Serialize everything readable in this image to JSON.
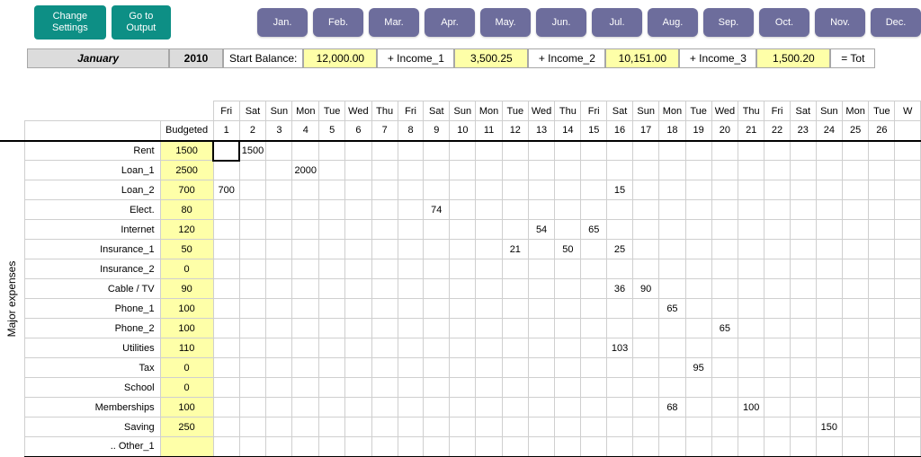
{
  "buttons": {
    "change_settings": "Change\nSettings",
    "goto_output": "Go to\nOutput"
  },
  "months": [
    "Jan.",
    "Feb.",
    "Mar.",
    "Apr.",
    "May.",
    "Jun.",
    "Jul.",
    "Aug.",
    "Sep.",
    "Oct.",
    "Nov.",
    "Dec."
  ],
  "balance_row": {
    "month_name": "January",
    "year": "2010",
    "start_balance_label": "Start Balance:",
    "start_balance": "12,000.00",
    "income1_label": "+ Income_1",
    "income1": "3,500.25",
    "income2_label": "+ Income_2",
    "income2": "10,151.00",
    "income3_label": "+ Income_3",
    "income3": "1,500.20",
    "total_label": "= Tot"
  },
  "header": {
    "budgeted": "Budgeted",
    "days_of_week": [
      "Fri",
      "Sat",
      "Sun",
      "Mon",
      "Tue",
      "Wed",
      "Thu",
      "Fri",
      "Sat",
      "Sun",
      "Mon",
      "Tue",
      "Wed",
      "Thu",
      "Fri",
      "Sat",
      "Sun",
      "Mon",
      "Tue",
      "Wed",
      "Thu",
      "Fri",
      "Sat",
      "Sun",
      "Mon",
      "Tue",
      "W"
    ],
    "day_numbers": [
      "1",
      "2",
      "3",
      "4",
      "5",
      "6",
      "7",
      "8",
      "9",
      "10",
      "11",
      "12",
      "13",
      "14",
      "15",
      "16",
      "17",
      "18",
      "19",
      "20",
      "21",
      "22",
      "23",
      "24",
      "25",
      "26",
      ""
    ]
  },
  "side_label": "Major expenses",
  "rows": [
    {
      "label": "Rent",
      "budget": "1500",
      "cells": {
        "2": "1500"
      }
    },
    {
      "label": "Loan_1",
      "budget": "2500",
      "cells": {
        "4": "2000"
      }
    },
    {
      "label": "Loan_2",
      "budget": "700",
      "cells": {
        "1": "700",
        "16": "15"
      }
    },
    {
      "label": "Elect.",
      "budget": "80",
      "cells": {
        "9": "74"
      }
    },
    {
      "label": "Internet",
      "budget": "120",
      "cells": {
        "13": "54",
        "15": "65"
      }
    },
    {
      "label": "Insurance_1",
      "budget": "50",
      "cells": {
        "12": "21",
        "14": "50",
        "16": "25"
      }
    },
    {
      "label": "Insurance_2",
      "budget": "0",
      "cells": {}
    },
    {
      "label": "Cable / TV",
      "budget": "90",
      "cells": {
        "16": "36",
        "17": "90"
      }
    },
    {
      "label": "Phone_1",
      "budget": "100",
      "cells": {
        "18": "65"
      }
    },
    {
      "label": "Phone_2",
      "budget": "100",
      "cells": {
        "20": "65"
      }
    },
    {
      "label": "Utilities",
      "budget": "110",
      "cells": {
        "16": "103"
      }
    },
    {
      "label": "Tax",
      "budget": "0",
      "cells": {
        "19": "95"
      }
    },
    {
      "label": "School",
      "budget": "0",
      "cells": {}
    },
    {
      "label": "Memberships",
      "budget": "100",
      "cells": {
        "18": "68",
        "21": "100"
      }
    },
    {
      "label": "Saving",
      "budget": "250",
      "cells": {
        "24": "150"
      }
    },
    {
      "label": ".. Other_1",
      "budget": "",
      "cells": {}
    }
  ]
}
